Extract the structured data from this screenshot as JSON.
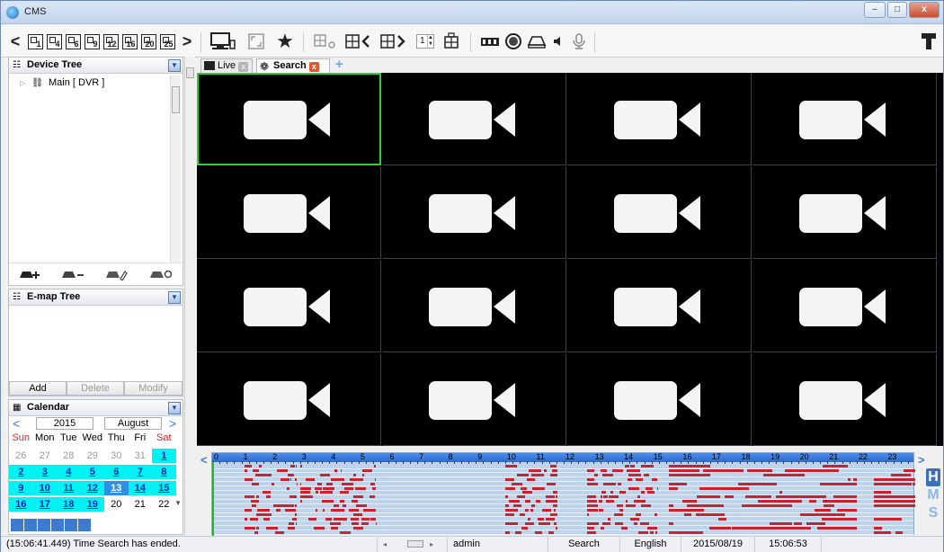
{
  "window": {
    "title": "CMS",
    "min_label": "–",
    "max_label": "□",
    "close_label": "x"
  },
  "toolbar": {
    "layouts": [
      {
        "label": "1"
      },
      {
        "label": "4"
      },
      {
        "label": "6"
      },
      {
        "label": "9"
      },
      {
        "label": "12"
      },
      {
        "label": "16"
      },
      {
        "label": "20"
      },
      {
        "label": "25"
      }
    ],
    "prev_label": "<",
    "next_label": ">",
    "channel_value": "1"
  },
  "device_tree": {
    "title": "Device Tree",
    "root_item": "Main [ DVR ]"
  },
  "emap_tree": {
    "title": "E-map Tree",
    "add_label": "Add",
    "delete_label": "Delete",
    "modify_label": "Modify"
  },
  "calendar": {
    "title": "Calendar",
    "year": "2015",
    "month": "August",
    "weekdays": [
      "Sun",
      "Mon",
      "Tue",
      "Wed",
      "Thu",
      "Fri",
      "Sat"
    ],
    "weeks": [
      [
        "26",
        "27",
        "28",
        "29",
        "30",
        "31",
        "1"
      ],
      [
        "2",
        "3",
        "4",
        "5",
        "6",
        "7",
        "8"
      ],
      [
        "9",
        "10",
        "11",
        "12",
        "13",
        "14",
        "15"
      ],
      [
        "16",
        "17",
        "18",
        "19",
        "20",
        "21",
        "22"
      ]
    ],
    "selected_day": "13",
    "recorded_days": [
      "1",
      "2",
      "3",
      "4",
      "5",
      "6",
      "7",
      "8",
      "9",
      "10",
      "11",
      "12",
      "13",
      "14",
      "15",
      "16",
      "17",
      "18",
      "19"
    ]
  },
  "tabs": [
    {
      "label": "Live",
      "active": false
    },
    {
      "label": "Search",
      "active": true
    }
  ],
  "timeline": {
    "hours": [
      "0",
      "1",
      "2",
      "3",
      "4",
      "5",
      "6",
      "7",
      "8",
      "9",
      "10",
      "11",
      "12",
      "13",
      "14",
      "15",
      "16",
      "17",
      "18",
      "19",
      "20",
      "21",
      "22",
      "23"
    ],
    "mode_buttons": [
      "H",
      "M",
      "S"
    ],
    "channel_count": 16,
    "record_color": "#c8232f",
    "background_color": "#bfd3ea"
  },
  "status": {
    "message": "(15:06:41.449)  Time Search has ended.",
    "user": "admin",
    "mode": "Search",
    "language": "English",
    "date": "2015/08/19",
    "time": "15:06:53"
  },
  "colors": {
    "selected_cell_border": "#2ad12a",
    "calendar_highlight": "#00f2f2",
    "calendar_selected": "#2e8fe8"
  }
}
